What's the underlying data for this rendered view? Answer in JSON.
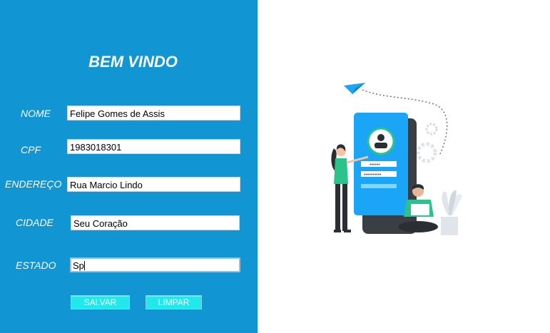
{
  "form": {
    "title": "BEM VINDO",
    "fields": [
      {
        "label": "NOME",
        "value": "Felipe Gomes de Assis"
      },
      {
        "label": "CPF",
        "value": "1983018301"
      },
      {
        "label": "ENDEREÇO",
        "value": "Rua Marcio Lindo"
      },
      {
        "label": "CIDADE",
        "value": "Seu Coração"
      },
      {
        "label": "ESTADO",
        "value": "Sp"
      }
    ],
    "buttons": {
      "save": "SALVAR",
      "clear": "LIMPAR"
    }
  },
  "colors": {
    "panel": "#1296d3",
    "button": "#22e8ec",
    "phone": "#1aa5f6",
    "accent_green": "#2cc28c"
  },
  "illustration": {
    "icons": [
      "paper-plane-icon",
      "user-profile-icon",
      "gear-icon",
      "plant-icon"
    ]
  }
}
